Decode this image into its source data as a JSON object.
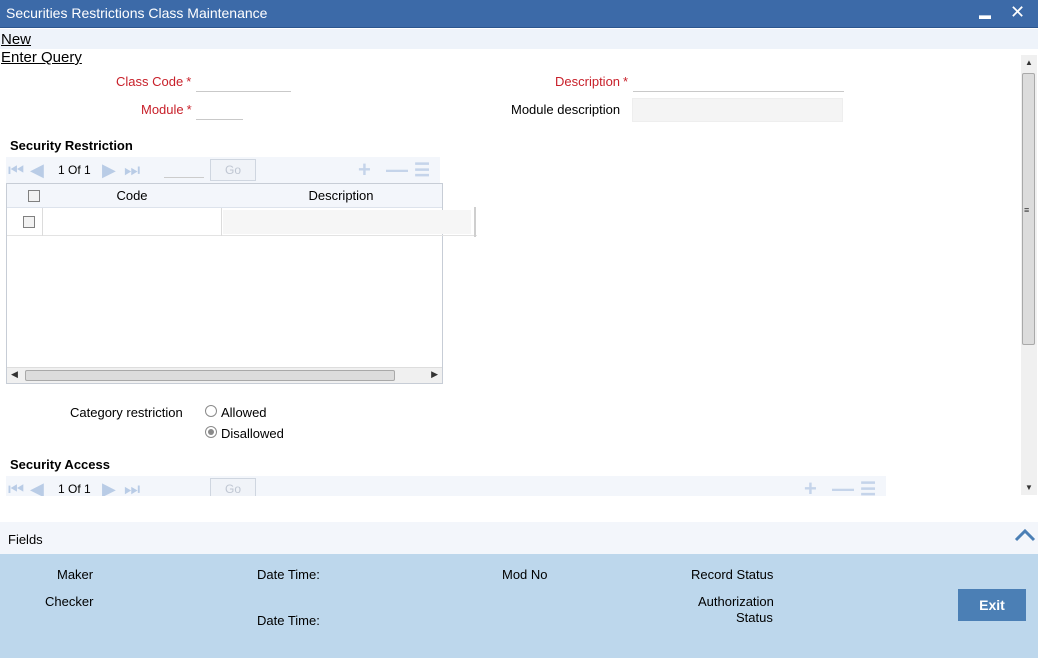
{
  "window": {
    "title": "Securities Restrictions Class Maintenance",
    "minimize_glyph": "▬",
    "close_glyph": "✕"
  },
  "menu": {
    "new_label": "New",
    "enter_query_label": "Enter Query"
  },
  "form": {
    "class_code_label": "Class Code",
    "module_label": "Module",
    "description_label": "Description",
    "module_description_label": "Module description",
    "required_marker": "*",
    "class_code_value": "",
    "module_value": "",
    "description_value": "",
    "module_description_value": ""
  },
  "security_restriction": {
    "title": "Security Restriction",
    "pager": {
      "current": "1",
      "of_label": "Of",
      "total": "1",
      "go_label": "Go"
    },
    "columns": [
      "Code",
      "Description"
    ],
    "rows": [
      {
        "code": "",
        "description": ""
      }
    ]
  },
  "category_restriction": {
    "label": "Category restriction",
    "options": [
      "Allowed",
      "Disallowed"
    ],
    "selected": "Disallowed"
  },
  "security_access": {
    "title": "Security Access",
    "pager": {
      "current": "1",
      "of_label": "Of",
      "total": "1",
      "go_label": "Go"
    }
  },
  "fields_label": "Fields",
  "footer": {
    "maker_label": "Maker",
    "checker_label": "Checker",
    "date_time_label": "Date Time:",
    "mod_no_label": "Mod No",
    "record_status_label": "Record Status",
    "authorization_label": "Authorization",
    "status_label": "Status",
    "exit_label": "Exit"
  },
  "colors": {
    "title_bar": "#3c6aa8",
    "required_label": "#c8202a",
    "footer_bg": "#bdd7ec",
    "exit_button": "#4b7fb5"
  },
  "icons": [
    "first-page-icon",
    "prev-page-icon",
    "next-page-icon",
    "last-page-icon",
    "add-row-icon",
    "delete-row-icon",
    "single-view-icon",
    "collapse-chevron-icon",
    "close-icon",
    "minimize-icon"
  ]
}
